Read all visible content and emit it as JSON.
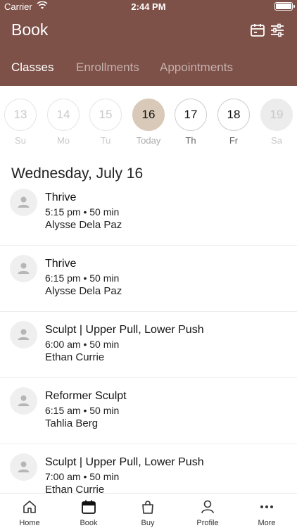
{
  "status_bar": {
    "carrier": "Carrier",
    "time": "2:44 PM"
  },
  "header": {
    "title": "Book"
  },
  "tabs": [
    {
      "label": "Classes",
      "active": true
    },
    {
      "label": "Enrollments",
      "active": false
    },
    {
      "label": "Appointments",
      "active": false
    }
  ],
  "date_strip": [
    {
      "day": "13",
      "label": "Su",
      "state": "past"
    },
    {
      "day": "14",
      "label": "Mo",
      "state": "past"
    },
    {
      "day": "15",
      "label": "Tu",
      "state": "past"
    },
    {
      "day": "16",
      "label": "Today",
      "state": "today"
    },
    {
      "day": "17",
      "label": "Th",
      "state": "active"
    },
    {
      "day": "18",
      "label": "Fr",
      "state": "active"
    },
    {
      "day": "19",
      "label": "Sa",
      "state": "disabled"
    }
  ],
  "date_heading": "Wednesday, July 16",
  "classes": [
    {
      "name": "Thrive",
      "time": "5:15 pm • 50 min",
      "instructor": "Alysse Dela Paz"
    },
    {
      "name": "Thrive",
      "time": "6:15 pm • 50 min",
      "instructor": "Alysse Dela Paz"
    },
    {
      "name": "Sculpt | Upper Pull, Lower Push",
      "time": "6:00 am • 50 min",
      "instructor": "Ethan Currie"
    },
    {
      "name": "Reformer Sculpt",
      "time": "6:15 am • 50 min",
      "instructor": "Tahlia Berg"
    },
    {
      "name": "Sculpt | Upper Pull, Lower Push",
      "time": "7:00 am • 50 min",
      "instructor": "Ethan Currie"
    }
  ],
  "bottom_nav": [
    {
      "label": "Home",
      "icon": "home-icon"
    },
    {
      "label": "Book",
      "icon": "book-calendar-icon",
      "active": true
    },
    {
      "label": "Buy",
      "icon": "shopping-bag-icon"
    },
    {
      "label": "Profile",
      "icon": "profile-icon"
    },
    {
      "label": "More",
      "icon": "more-icon"
    }
  ],
  "colors": {
    "header": "#7d5048",
    "today": "#d9c9b8"
  }
}
